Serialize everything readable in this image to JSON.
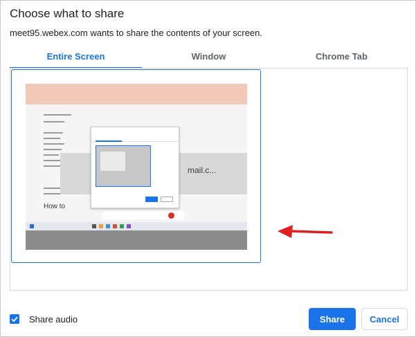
{
  "dialog": {
    "title": "Choose what to share",
    "subtitle": "meet95.webex.com wants to share the contents of your screen."
  },
  "tabs": [
    {
      "label": "Entire Screen",
      "active": true
    },
    {
      "label": "Window",
      "active": false
    },
    {
      "label": "Chrome Tab",
      "active": false
    }
  ],
  "thumbnail": {
    "mail_text": "mail.c...",
    "heading_text": "How to"
  },
  "audio": {
    "label": "Share audio",
    "checked": true
  },
  "buttons": {
    "share": "Share",
    "cancel": "Cancel"
  },
  "colors": {
    "accent": "#1a73e8",
    "arrow": "#e02020"
  },
  "icons": {
    "checkbox": "check-icon",
    "annotation": "arrow-left-icon"
  }
}
